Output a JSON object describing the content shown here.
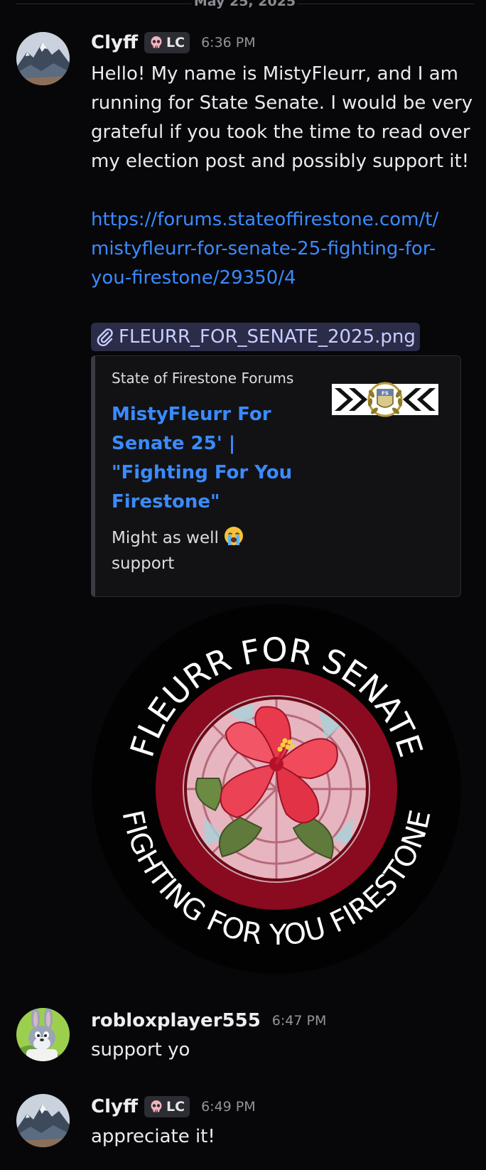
{
  "divider": {
    "date": "May 25, 2025"
  },
  "messages": [
    {
      "username": "Clyff",
      "role_tag": "LC",
      "time": "6:36 PM",
      "lines": [
        "Hello! My name is MistyFleurr, and I am",
        "running for State Senate. I would be very",
        "grateful if you took the time to read over",
        "my election post and possibly support it!"
      ],
      "link_lines": [
        "https://forums.stateoffirestone.com/t/",
        "mistyfleurr-for-senate-25-fighting-for-",
        "you-firestone/29350/4"
      ],
      "attachment": "FLEURR_FOR_SENATE_2025.png",
      "embed": {
        "provider": "State of Firestone Forums",
        "title_lines": [
          "MistyFleurr For",
          "Senate 25' |",
          "\"Fighting For You",
          "Firestone\""
        ],
        "desc_line1": "Might as well",
        "desc_line2": "support",
        "emoji": "loudly-crying-face"
      },
      "image": {
        "top_text": "FLEURR FOR SENATE",
        "bottom_text": "FIGHTING FOR YOU FIRESTONE"
      }
    },
    {
      "username": "robloxplayer555",
      "time": "6:47 PM",
      "text": "support yo"
    },
    {
      "username": "Clyff",
      "role_tag": "LC",
      "time": "6:49 PM",
      "text": "appreciate it!"
    }
  ],
  "colors": {
    "background": "#070709",
    "link": "#3a8bff",
    "attachment_bg": "#2a2c48",
    "seal_red": "#8a0a1f"
  }
}
